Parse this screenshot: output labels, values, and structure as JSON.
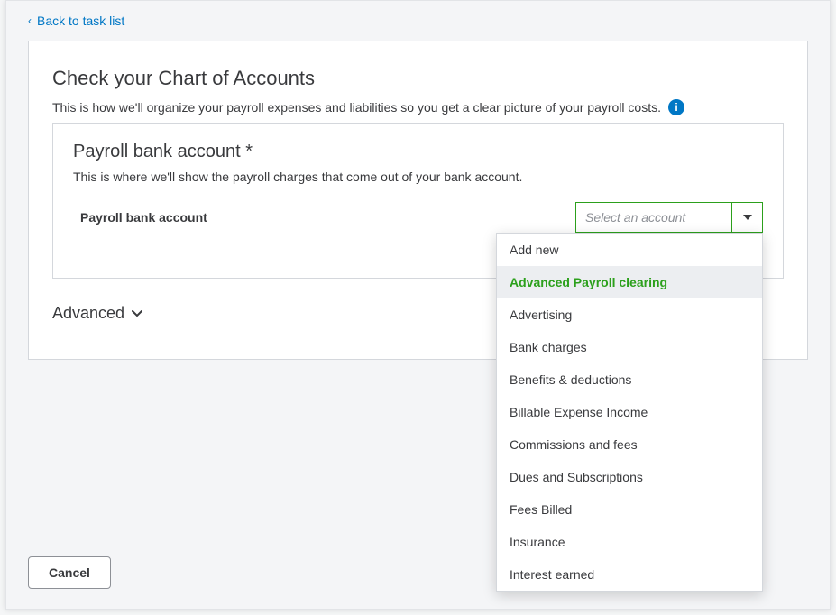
{
  "nav": {
    "back_label": "Back to task list"
  },
  "page": {
    "title": "Check your Chart of Accounts",
    "description": "This is how we'll organize your payroll expenses and liabilities so you get a clear picture of your payroll costs."
  },
  "section": {
    "title": "Payroll bank account *",
    "description": "This is where we'll show the payroll charges that come out of your bank account.",
    "field_label": "Payroll bank account",
    "select_placeholder": "Select an account"
  },
  "dropdown": {
    "options": [
      "Add new",
      "Advanced Payroll clearing",
      "Advertising",
      "Bank charges",
      "Benefits & deductions",
      "Billable Expense Income",
      "Commissions and fees",
      "Dues and Subscriptions",
      "Fees Billed",
      "Insurance",
      "Interest earned"
    ],
    "selected_index": 1
  },
  "advanced": {
    "label": "Advanced"
  },
  "footer": {
    "cancel_label": "Cancel"
  },
  "colors": {
    "brand_blue": "#0077c5",
    "brand_green": "#2ca01c",
    "text": "#393a3d",
    "border": "#d4d7dc"
  }
}
